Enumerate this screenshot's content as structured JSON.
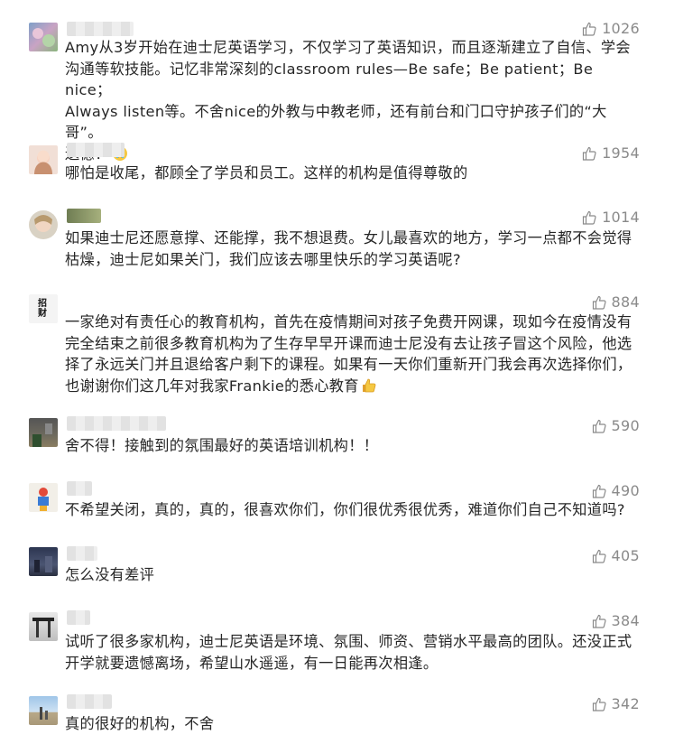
{
  "comments": [
    {
      "likes": "1026",
      "lines": [
        "Amy从3岁开始在迪士尼英语学习，不仅学习了英语知识，而且逐渐建立了自信、学会",
        "沟通等软技能。记忆非常深刻的classroom rules—Be safe；Be patient；Be nice；",
        "Always listen等。不舍nice的外教与中教老师，还有前台和门口守护孩子们的“大哥”。",
        "遗憾！"
      ]
    },
    {
      "likes": "1954",
      "lines": [
        "哪怕是收尾，都顾全了学员和员工。这样的机构是值得尊敬的"
      ]
    },
    {
      "likes": "1014",
      "lines": [
        "如果迪士尼还愿意撑、还能撑，我不想退费。女儿最喜欢的地方，学习一点都不会觉得",
        "枯燥，迪士尼如果关门，我们应该去哪里快乐的学习英语呢?"
      ]
    },
    {
      "likes": "884",
      "avatar_text": "招财",
      "lines": [
        "一家绝对有责任心的教育机构，首先在疫情期间对孩子免费开网课，现如今在疫情没有",
        "完全结束之前很多教育机构为了生存早早开课而迪士尼没有去让孩子冒这个风险，他选",
        "择了永远关门并且退给客户剩下的课程。如果有一天你们重新开门我会再次选择你们，",
        "也谢谢你们这几年对我家Frankie的悉心教育"
      ]
    },
    {
      "likes": "590",
      "lines": [
        "舍不得！接触到的氛围最好的英语培训机构！！"
      ]
    },
    {
      "likes": "490",
      "lines": [
        "不希望关闭，真的，真的，很喜欢你们，你们很优秀很优秀，难道你们自己不知道吗?"
      ]
    },
    {
      "likes": "405",
      "lines": [
        "怎么没有差评"
      ]
    },
    {
      "likes": "384",
      "lines": [
        "试听了很多家机构，迪士尼英语是环境、氛围、师资、营销水平最高的团队。还没正式",
        "开学就要遗憾离场，希望山水遥遥，有一日能再次相逢。"
      ]
    },
    {
      "likes": "342",
      "lines": [
        "真的很好的机构，不舍"
      ]
    }
  ],
  "icons": {
    "like": "thumbs-up-icon",
    "emoji_sad": "crying-face-emoji-icon",
    "emoji_thumb": "thumbs-up-emoji-icon"
  },
  "colors": {
    "like_gray": "#8a8a8a",
    "text": "#262626"
  }
}
